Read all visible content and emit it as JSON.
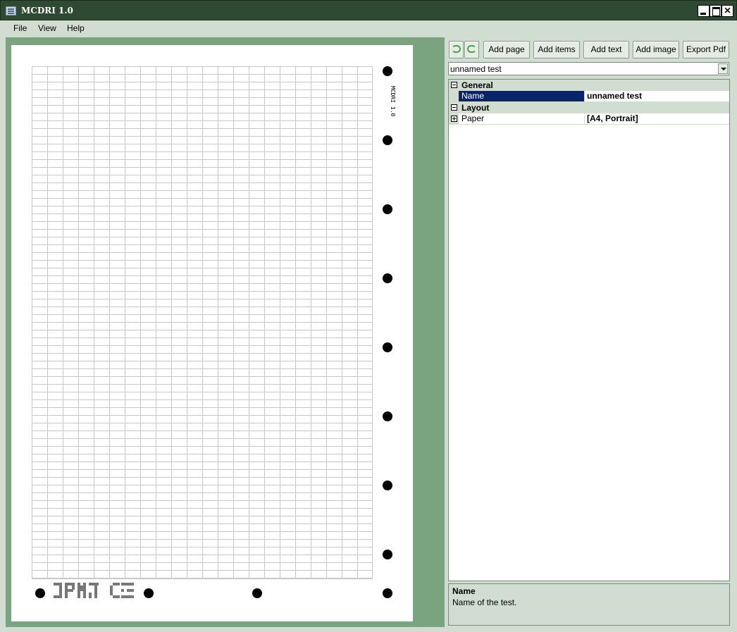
{
  "window": {
    "title": "MCDRI 1.0"
  },
  "menu": {
    "items": [
      "File",
      "View",
      "Help"
    ]
  },
  "toolbar": {
    "undo_icon": "undo-icon",
    "redo_icon": "redo-icon",
    "add_page": "Add page",
    "add_items": "Add items",
    "add_text": "Add text",
    "add_image": "Add image",
    "export_pdf": "Export Pdf",
    "accent": "#4aa34a"
  },
  "selector": {
    "value": "unnamed test"
  },
  "properties": {
    "general": {
      "label": "General",
      "name_label": "Name",
      "name_value": "unnamed test"
    },
    "layout": {
      "label": "Layout",
      "paper_label": "Paper",
      "paper_value": "[A4, Portrait]"
    }
  },
  "help": {
    "title": "Name",
    "description": "Name of the test."
  },
  "canvas": {
    "vertical_label": "MCDRI 1.0",
    "page_color": "#ffffff",
    "background_color": "#7aa37f"
  }
}
